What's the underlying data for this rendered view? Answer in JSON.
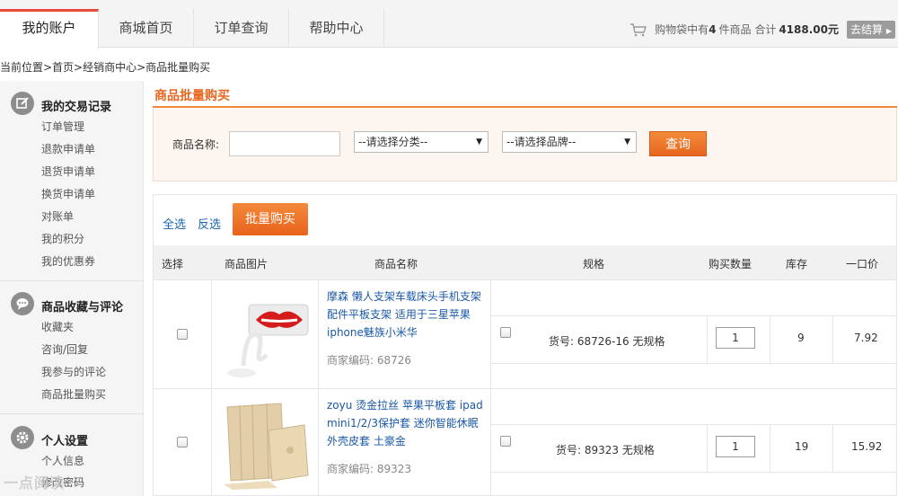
{
  "top_nav": {
    "tabs": [
      {
        "label": "我的账户",
        "active": true
      },
      {
        "label": "商城首页",
        "active": false
      },
      {
        "label": "订单查询",
        "active": false
      },
      {
        "label": "帮助中心",
        "active": false
      }
    ],
    "cart": {
      "prefix": "购物袋中有",
      "count": "4",
      "mid": "件商品 合计",
      "total": "4188.00元",
      "icon": "cart-icon"
    },
    "checkout_label": "去结算"
  },
  "breadcrumb": "当前位置>首页>经销商中心>商品批量购买",
  "sidebar": {
    "sections": [
      {
        "title": "我的交易记录",
        "icon": "edit-icon",
        "items": [
          "订单管理",
          "退款申请单",
          "退货申请单",
          "换货申请单",
          "对账单",
          "我的积分",
          "我的优惠券"
        ]
      },
      {
        "title": "商品收藏与评论",
        "icon": "chat-icon",
        "items": [
          "收藏夹",
          "咨询/回复",
          "我参与的评论",
          "商品批量购买"
        ]
      },
      {
        "title": "个人设置",
        "icon": "gear-icon",
        "items": [
          "个人信息",
          "修改密码"
        ]
      }
    ]
  },
  "main": {
    "title": "商品批量购买",
    "search": {
      "name_label": "商品名称:",
      "name_value": "",
      "category_select": "--请选择分类--",
      "brand_select": "--请选择品牌--",
      "query_label": "查询"
    },
    "toolbar": {
      "select_all": "全选",
      "invert": "反选",
      "batch_buy": "批量购买"
    },
    "columns": [
      "选择",
      "商品图片",
      "商品名称",
      "规格",
      "购买数量",
      "库存",
      "一口价"
    ],
    "rows": [
      {
        "name": "摩森 懒人支架车载床头手机支架配件平板支架 适用于三星苹果iphone魅族小米华",
        "code_label": "商家编码:",
        "code": "68726",
        "spec": "货号: 68726-16 无规格",
        "qty": "1",
        "stock": "9",
        "price": "7.92"
      },
      {
        "name": "zoyu 烫金拉丝 苹果平板套 ipad mini1/2/3保护套 迷你智能休眠外壳皮套 土豪金",
        "code_label": "商家编码:",
        "code": "89323",
        "spec": "货号: 89323 无规格",
        "qty": "1",
        "stock": "19",
        "price": "15.92"
      }
    ]
  },
  "watermark": "一点阅读"
}
